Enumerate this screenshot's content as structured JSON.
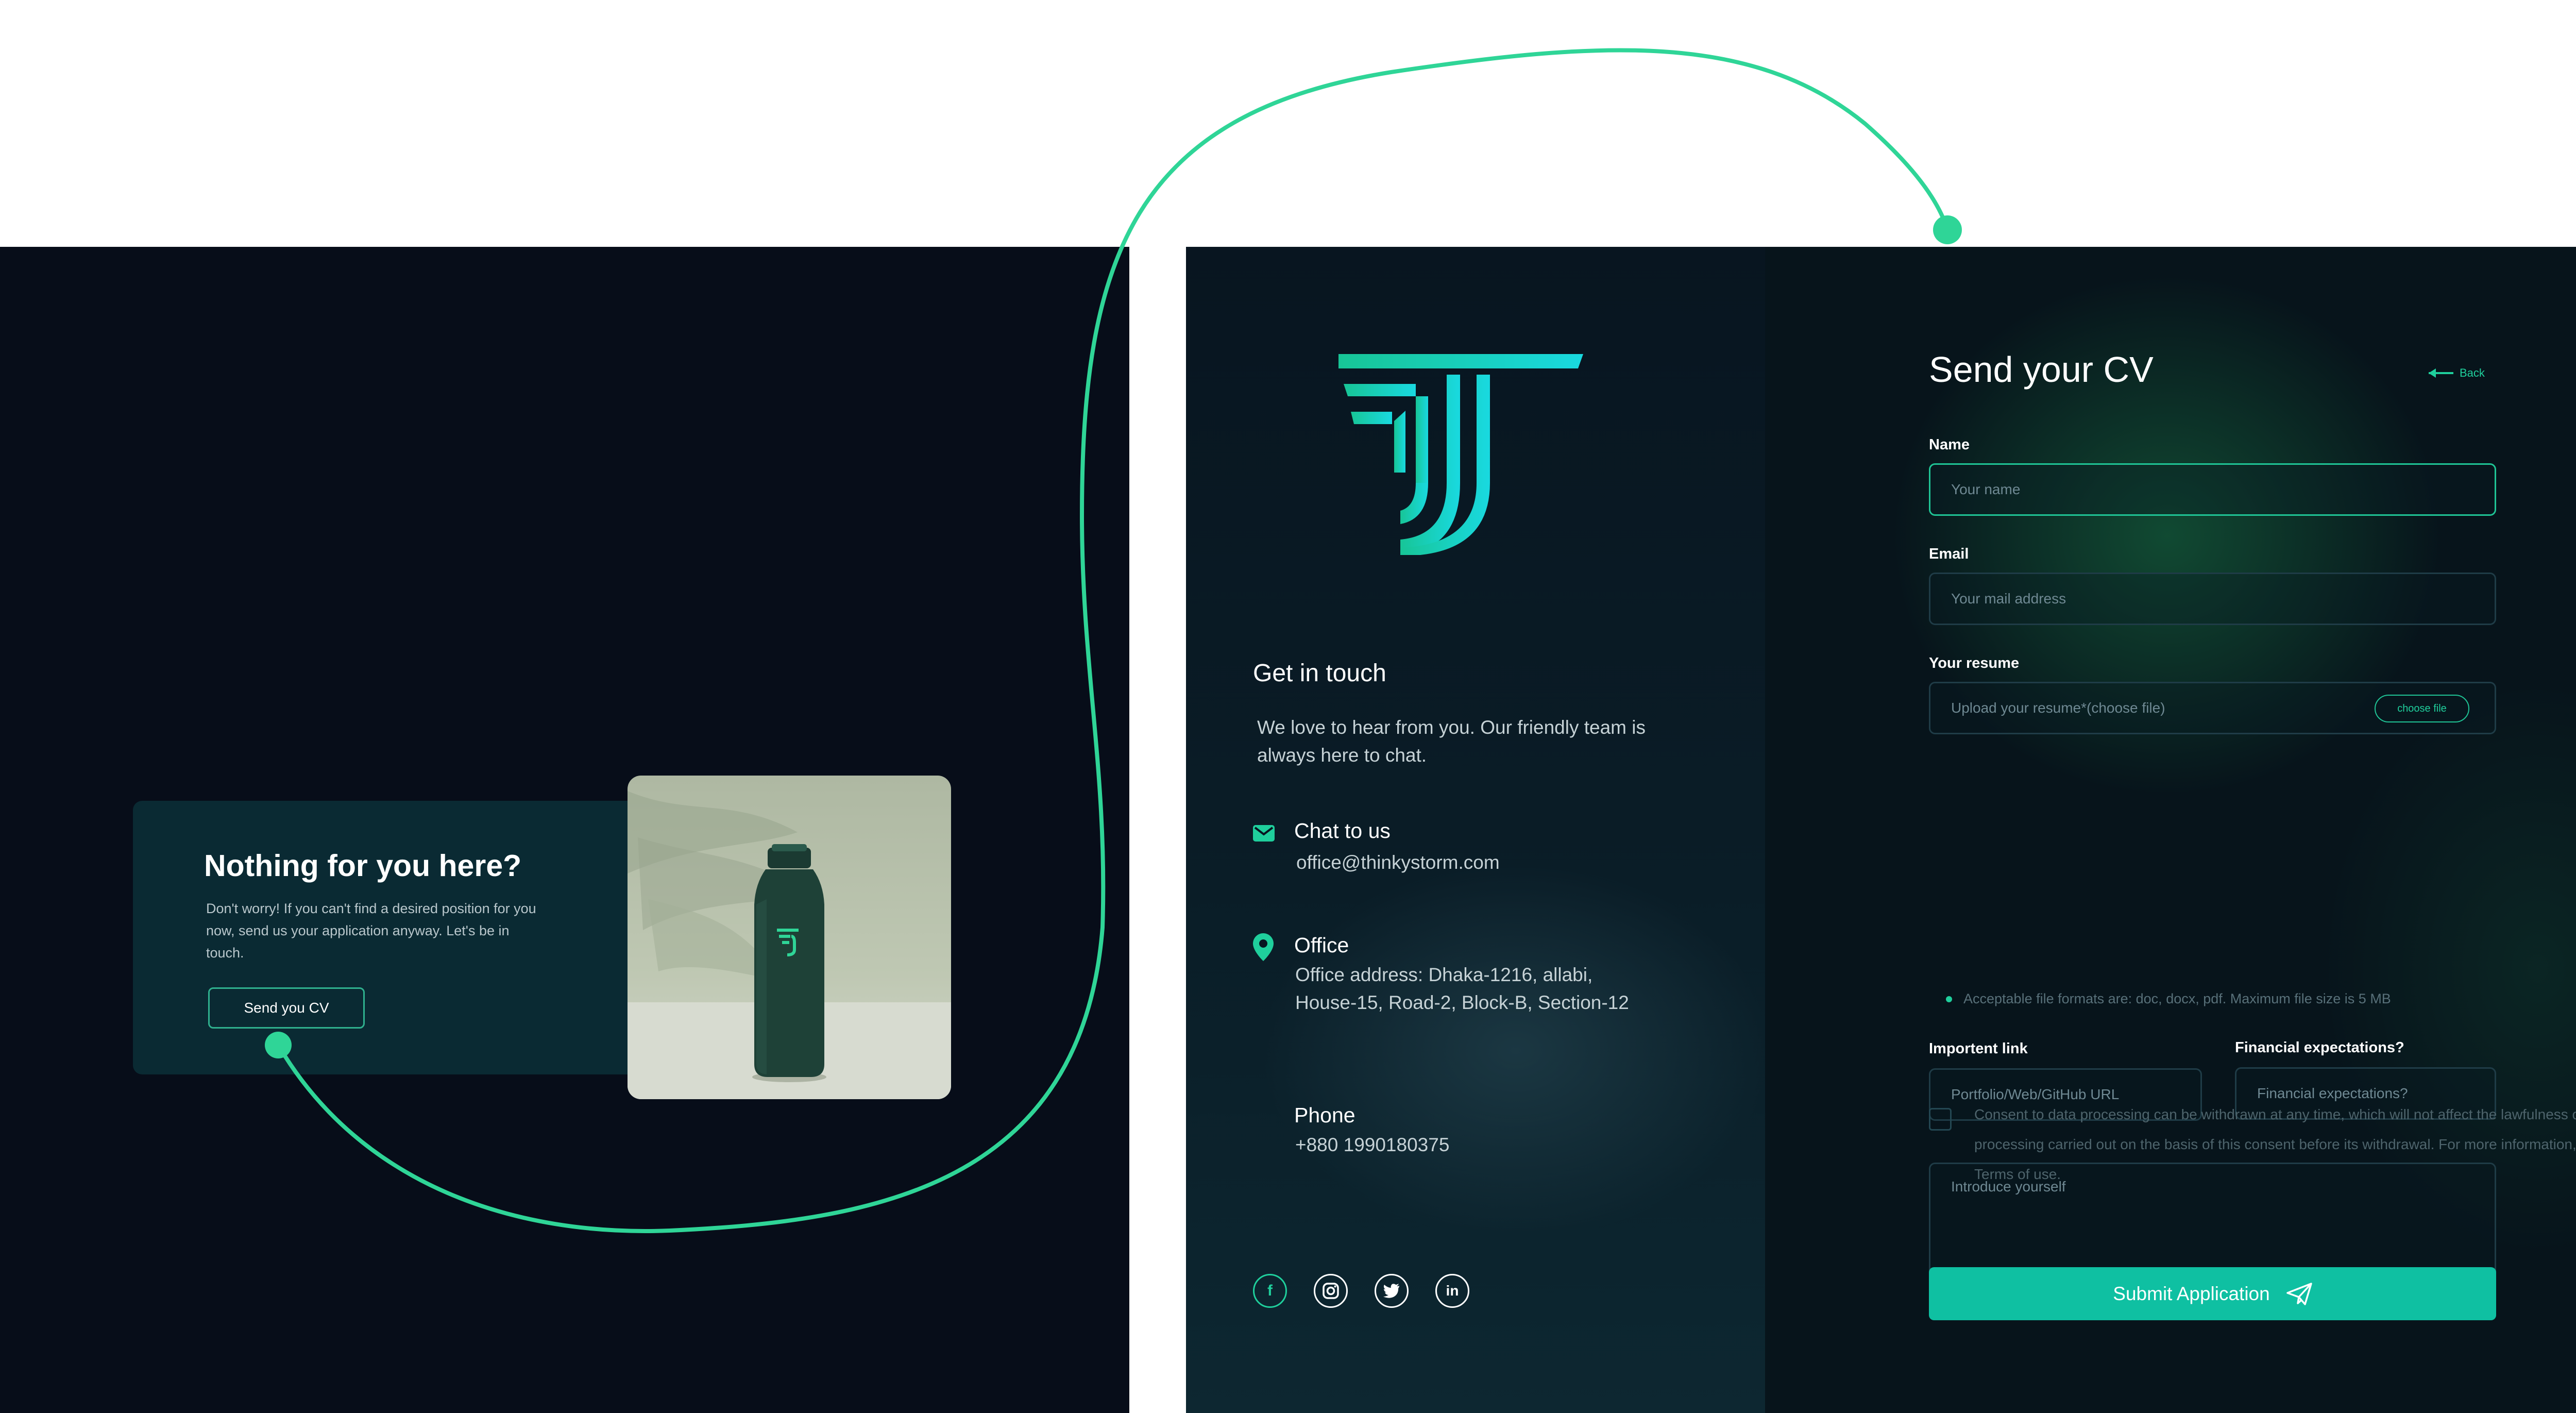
{
  "promo": {
    "title": "Nothing for you here?",
    "body": "Don't worry! If you can't find a desired position for you now, send us your application anyway. Let's be in touch.",
    "button_label": "Send you CV"
  },
  "contact": {
    "heading": "Get in touch",
    "intro": "We love to hear from you. Our friendly team is always here to chat.",
    "chat_label": "Chat to us",
    "chat_value": "office@thinkystorm.com",
    "office_label": "Office",
    "office_value": "Office address: Dhaka-1216, allabi, House-15, Road-2, Block-B, Section-12",
    "phone_label": "Phone",
    "phone_value": "+880 1990180375",
    "socials": [
      "facebook-icon",
      "instagram-icon",
      "twitter-icon",
      "linkedin-icon"
    ]
  },
  "form": {
    "title": "Send your CV",
    "back_label": "Back",
    "name_label": "Name",
    "name_placeholder": "Your name",
    "email_label": "Email",
    "email_placeholder": "Your mail address",
    "resume_label": "Your resume",
    "resume_placeholder": "Upload your resume*(choose file)",
    "choose_file_label": "choose file",
    "resume_hint": "Acceptable file formats are: doc, docx, pdf. Maximum file size is 5 MB",
    "link_label": "Importent link",
    "link_placeholder": "Portfolio/Web/GitHub URL",
    "finance_label": "Financial expectations?",
    "finance_placeholder": "Financial expectations?",
    "intro_placeholder": "Introduce yourself",
    "consent_text": "Consent to data processing can be withdrawn at any time, which will not affect the lawfulness of the processing carried out on the basis of this consent before its withdrawal. For more information, please visit Terms of use.",
    "submit_label": "Submit Application"
  },
  "colors": {
    "accent": "#1fcf9c",
    "button": "#0fc0a2",
    "background": "#070d19",
    "connector": "#2fd597"
  }
}
